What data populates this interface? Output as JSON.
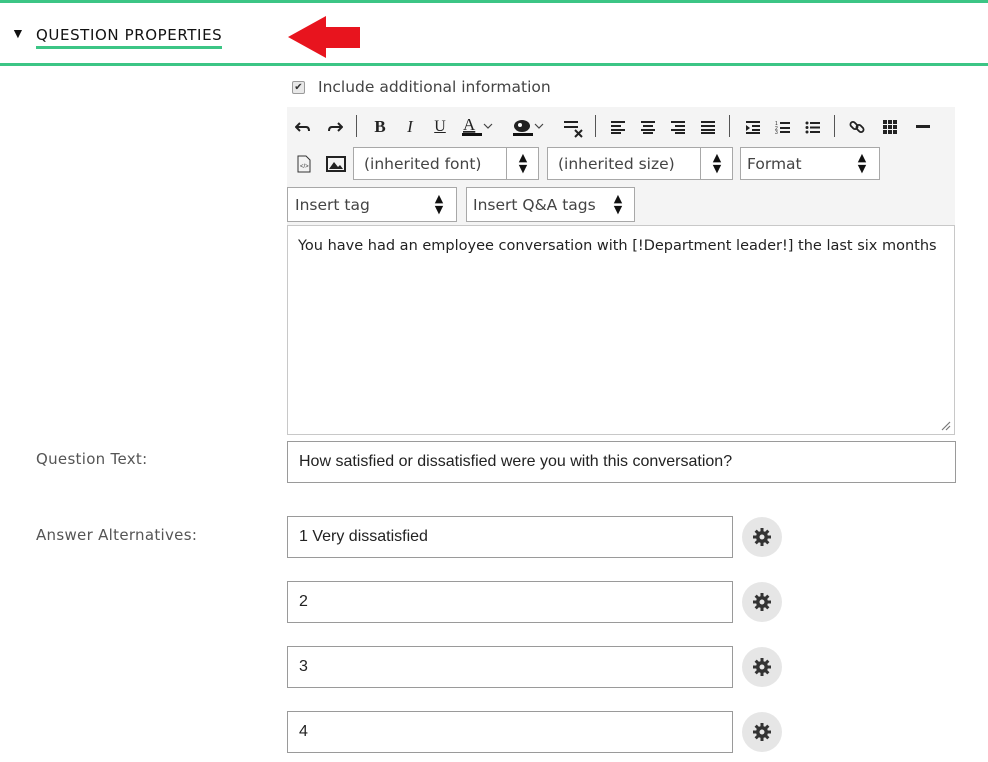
{
  "section": {
    "caret": "▼",
    "title": "QUESTION PROPERTIES"
  },
  "additional_info": {
    "checked": true,
    "label": "Include additional information"
  },
  "editor": {
    "toolbar": {
      "row1_icons": [
        "undo-icon",
        "redo-icon",
        "bold-icon",
        "italic-icon",
        "underline-icon",
        "text-color-icon",
        "background-color-icon",
        "remove-format-icon",
        "align-left-icon",
        "align-center-icon",
        "align-right-icon",
        "align-justify-icon",
        "indent-icon",
        "numbered-list-icon",
        "bulleted-list-icon",
        "link-icon",
        "table-icon",
        "horizontal-rule-icon"
      ],
      "font_select": "(inherited font)",
      "size_select": "(inherited size)",
      "format_select": "Format",
      "insert_tag_select": "Insert tag",
      "insert_qa_tags_select": "Insert Q&A tags"
    },
    "content": "You have had an employee conversation with [!Department leader!] the last six months"
  },
  "question_text": {
    "label": "Question Text:",
    "value": "How satisfied or dissatisfied were you with this conversation?"
  },
  "answers": {
    "label": "Answer Alternatives:",
    "items": [
      {
        "value": "1 Very dissatisfied"
      },
      {
        "value": "2"
      },
      {
        "value": "3"
      },
      {
        "value": "4"
      }
    ]
  },
  "colors": {
    "accent": "#3cc585",
    "arrow": "#e8141e"
  }
}
